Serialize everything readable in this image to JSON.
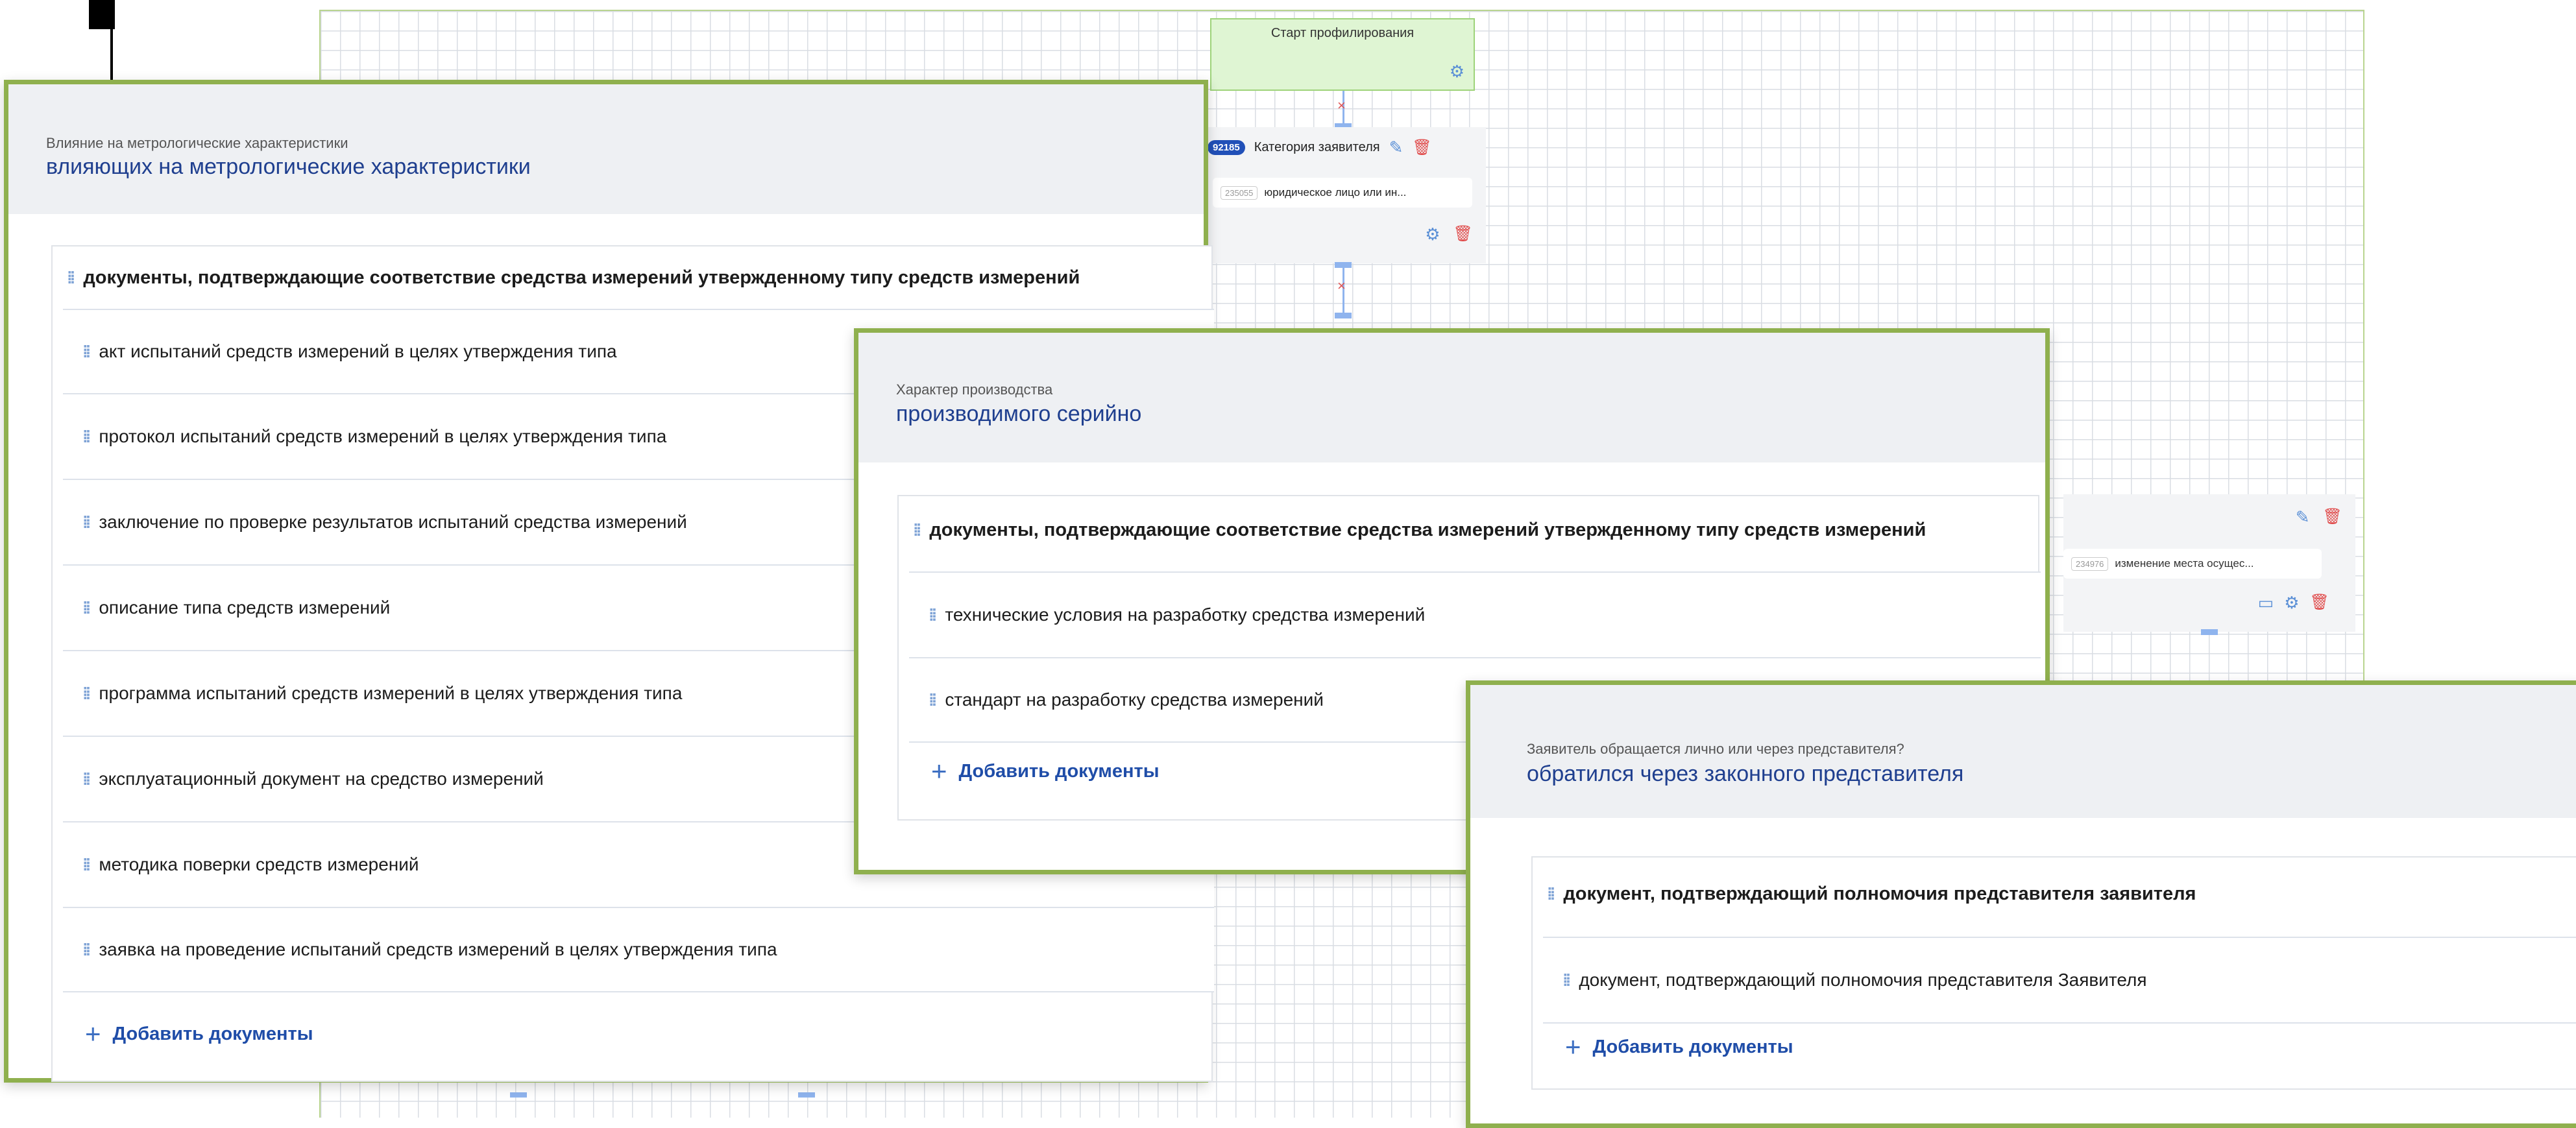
{
  "flow": {
    "start_node": {
      "title": "Старт профилирования",
      "icon": "gear-icon"
    },
    "category_node": {
      "badge": "92185",
      "title": "Категория заявителя",
      "option_id": "235055",
      "option_text": "юридическое лицо или ин..."
    },
    "right_node": {
      "option_id": "234976",
      "option_text": "изменение места осущес..."
    }
  },
  "panels": [
    {
      "kicker": "Влияние на метрологические характеристики",
      "heading": "влияющих на метрологические характеристики",
      "section_title": "документы, подтверждающие соответствие средства измерений утвержденному типу средств измерений",
      "documents": [
        "акт испытаний средств измерений в целях утверждения типа",
        "протокол испытаний средств измерений в целях утверждения типа",
        "заключение по проверке результатов испытаний средства измерений",
        "описание типа средств измерений",
        "программа испытаний средств измерений в целях утверждения типа",
        "эксплуатационный документ на средство измерений",
        "методика поверки средств измерений",
        "заявка на проведение испытаний средств измерений в целях утверждения типа"
      ],
      "add_label": "Добавить документы"
    },
    {
      "kicker": "Характер производства",
      "heading": "производимого серийно",
      "section_title": "документы, подтверждающие соответствие средства измерений утвержденному типу средств измерений",
      "documents": [
        "технические условия на разработку средства измерений",
        "стандарт на разработку средства измерений"
      ],
      "add_label": "Добавить документы"
    },
    {
      "kicker": "Заявитель обращается лично или через представителя?",
      "heading": "обратился через законного представителя",
      "section_title": "документ, подтверждающий полномочия представителя заявителя",
      "documents": [
        "документ, подтверждающий полномочия представителя Заявителя"
      ],
      "add_label": "Добавить документы"
    }
  ],
  "colors": {
    "panel_border": "#8fb04e",
    "heading": "#1f3f8f",
    "link": "#1f4da8",
    "delete": "#e04b4b"
  }
}
